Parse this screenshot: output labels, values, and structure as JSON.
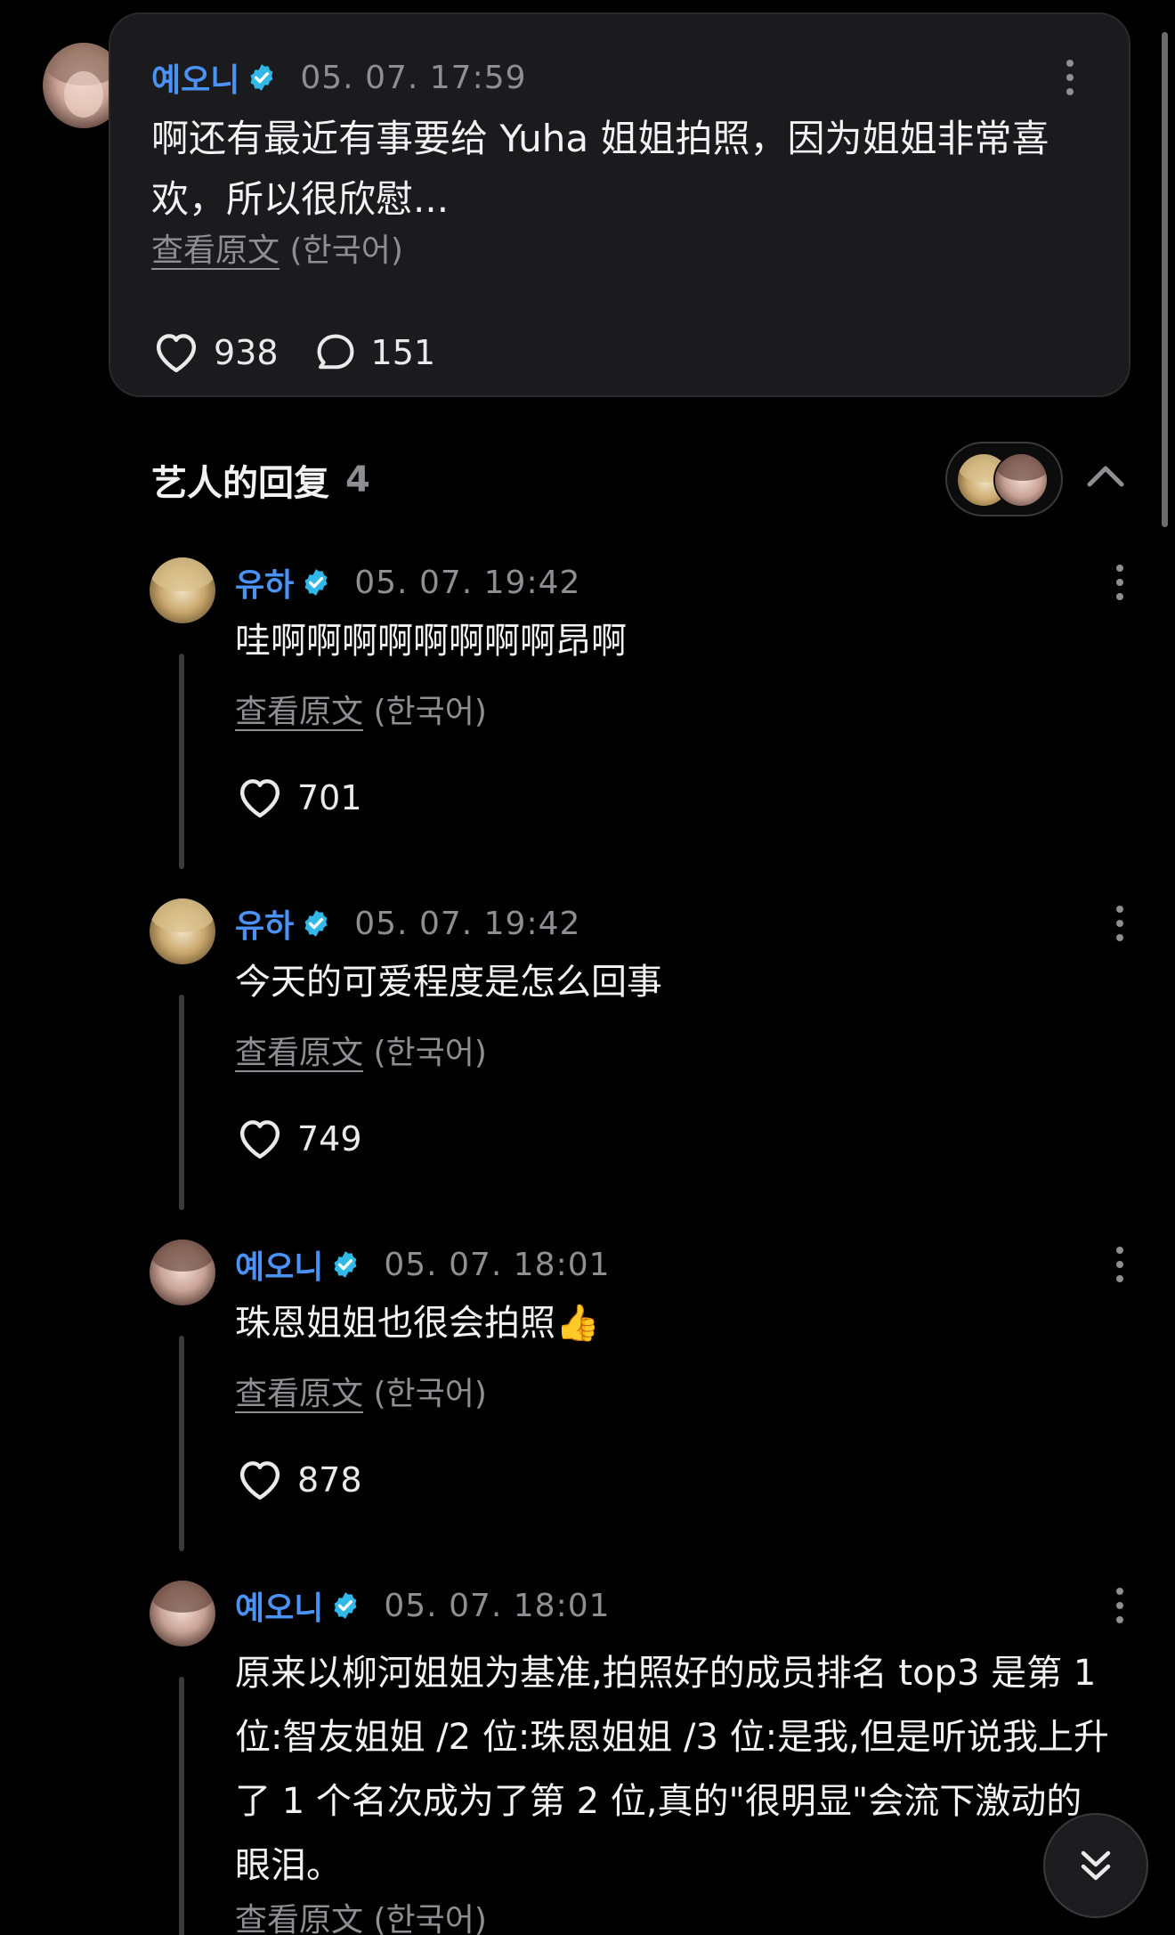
{
  "post": {
    "author": "예오니",
    "timestamp": "05. 07. 17:59",
    "text": "啊还有最近有事要给 Yuha 姐姐拍照，因为姐姐非常喜欢，所以很欣慰...",
    "translate_link": "查看原文",
    "translate_lang": "(한국어)",
    "likes": "938",
    "comments": "151"
  },
  "replies_section": {
    "title": "艺人的回复",
    "count": "4"
  },
  "replies": [
    {
      "author": "유하",
      "timestamp": "05. 07. 19:42",
      "text": "哇啊啊啊啊啊啊啊啊昂啊",
      "translate_link": "查看原文",
      "translate_lang": "(한국어)",
      "likes": "701"
    },
    {
      "author": "유하",
      "timestamp": "05. 07. 19:42",
      "text": "今天的可爱程度是怎么回事",
      "translate_link": "查看原文",
      "translate_lang": "(한국어)",
      "likes": "749"
    },
    {
      "author": "예오니",
      "timestamp": "05. 07. 18:01",
      "text": "珠恩姐姐也很会拍照👍",
      "translate_link": "查看原文",
      "translate_lang": "(한국어)",
      "likes": "878"
    },
    {
      "author": "예오니",
      "timestamp": "05. 07. 18:01",
      "text": "原来以柳河姐姐为基准,拍照好的成员排名 top3 是第 1 位:智友姐姐 /2 位:珠恩姐姐 /3 位:是我,但是听说我上升了 1 个名次成为了第 2 位,真的\"很明显\"会流下激动的眼泪。",
      "translate_link": "查看原文",
      "translate_lang": "(한국어)"
    }
  ],
  "colors": {
    "name": "#4a93f5",
    "verified": "#2fb8e8",
    "muted": "#8e8e93",
    "card": "#1b1b1d"
  },
  "icons": [
    "verified-icon",
    "more-vertical-icon",
    "heart-icon",
    "comment-icon",
    "chevron-up-icon",
    "double-chevron-down-icon"
  ]
}
